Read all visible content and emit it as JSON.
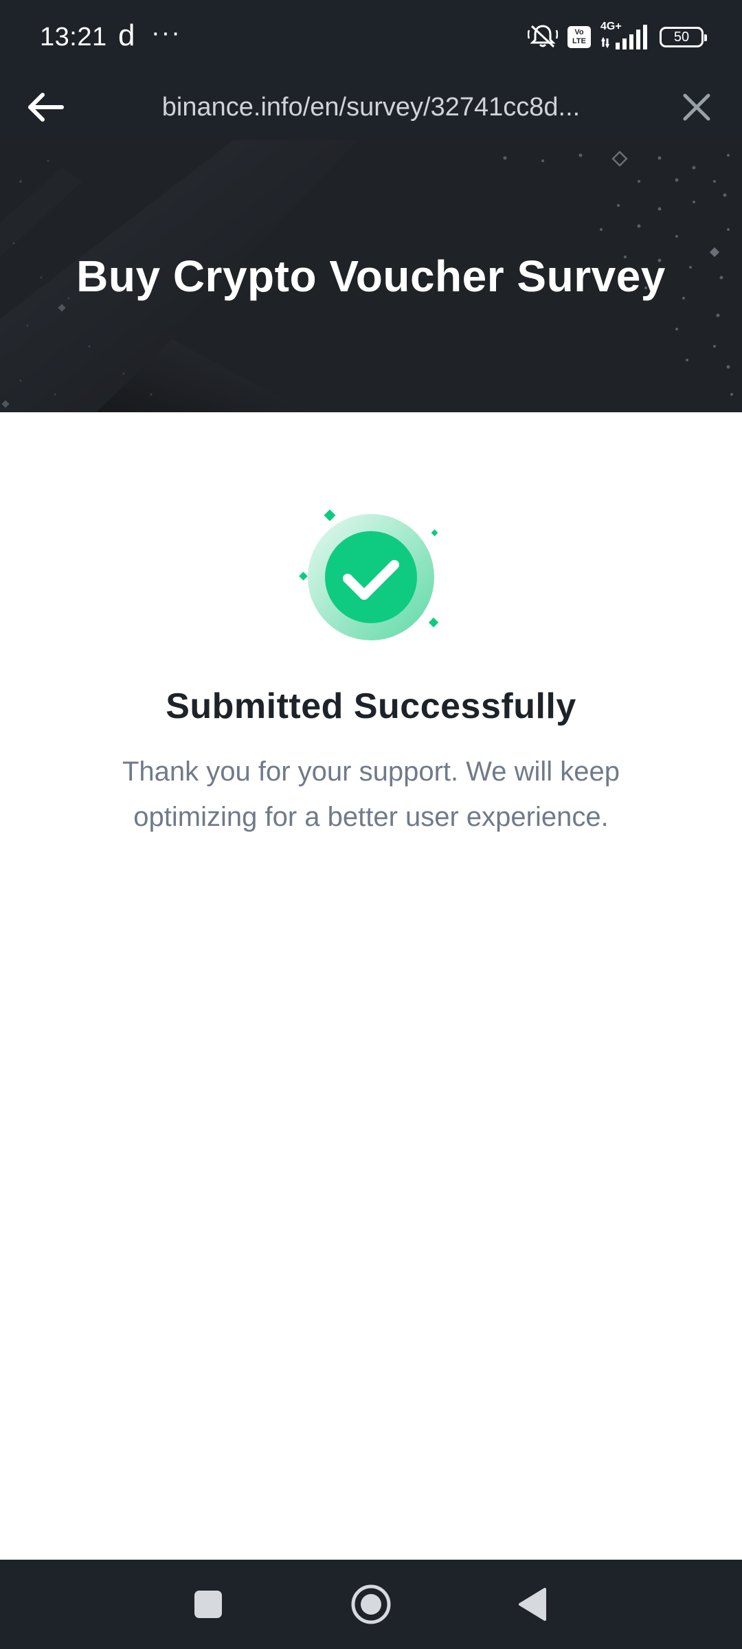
{
  "status_bar": {
    "time": "13:21",
    "app_glyph": "d",
    "more_indicator": "···",
    "volte_label": "Vo LTE",
    "network_label": "4G+",
    "battery_level": "50",
    "icons": [
      "silent-mode-icon",
      "volte-icon",
      "signal-icon",
      "battery-icon"
    ]
  },
  "browser": {
    "url": "binance.info/en/survey/32741cc8d...",
    "back_icon": "arrow-left-icon",
    "close_icon": "close-icon"
  },
  "banner": {
    "title": "Buy Crypto Voucher Survey"
  },
  "result": {
    "icon": "check-circle-icon",
    "title": "Submitted Successfully",
    "message": "Thank you for your support. We will keep optimizing for a better user experience."
  },
  "nav": {
    "icons": [
      "recents-square-icon",
      "home-circle-icon",
      "back-triangle-icon"
    ]
  },
  "colors": {
    "dark_bg": "#1e2329",
    "success_green": "#0ecb81",
    "text_primary": "#1e2329",
    "text_secondary": "#707a8a"
  }
}
